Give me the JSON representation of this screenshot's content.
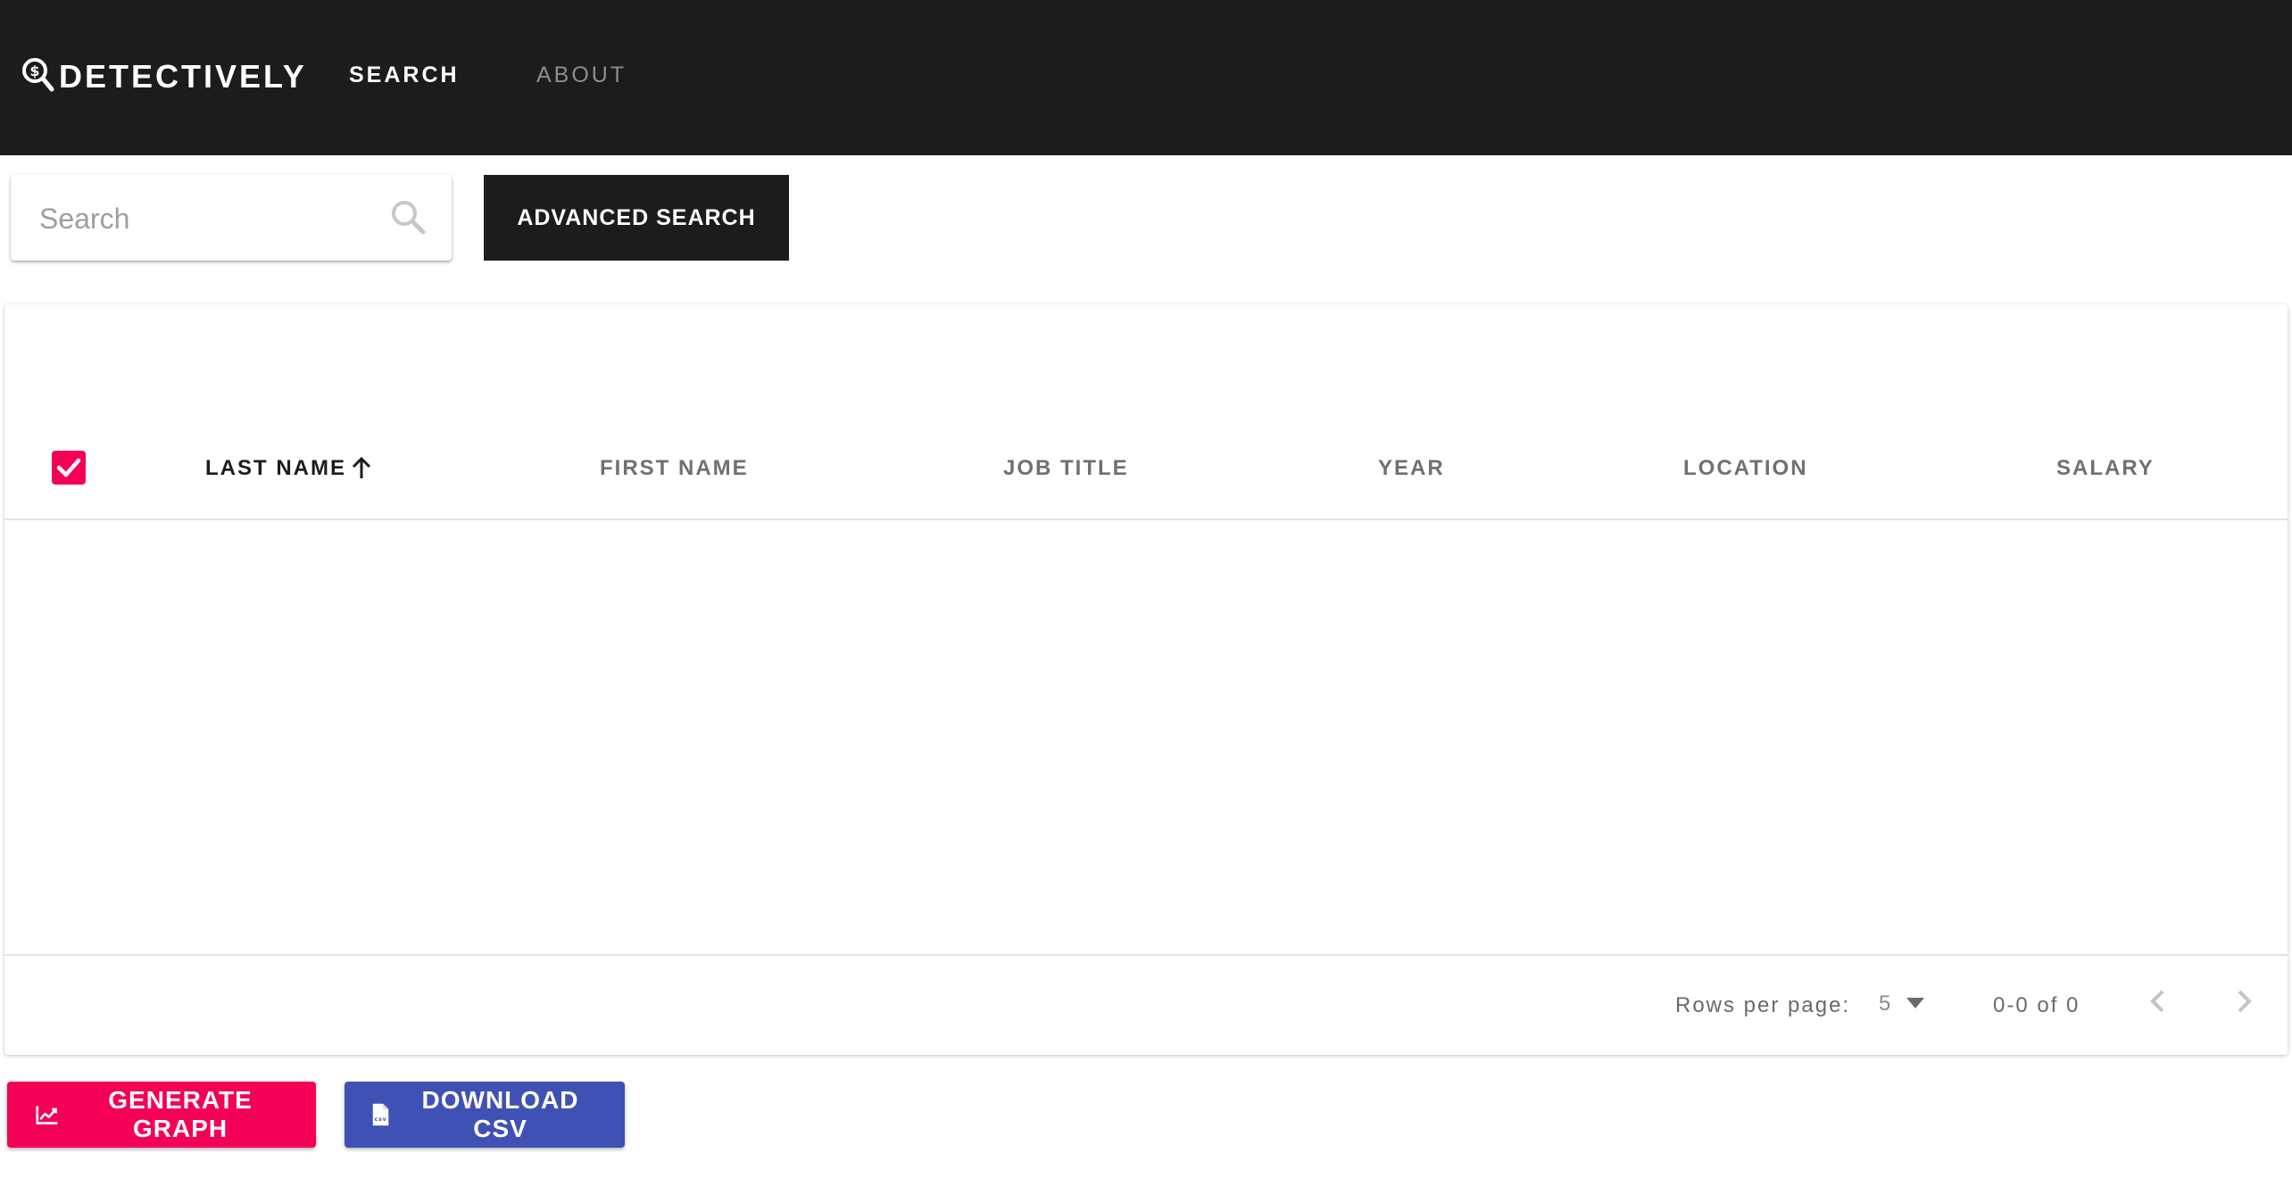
{
  "app": {
    "brand": "DETECTIVELY",
    "nav": [
      {
        "label": "SEARCH",
        "active": true
      },
      {
        "label": "ABOUT",
        "active": false
      }
    ]
  },
  "search": {
    "placeholder": "Search",
    "value": "",
    "advanced_label": "ADVANCED SEARCH"
  },
  "table": {
    "select_all_checked": true,
    "columns": [
      {
        "label": "LAST NAME",
        "sorted": "ascending"
      },
      {
        "label": "FIRST NAME"
      },
      {
        "label": "JOB TITLE"
      },
      {
        "label": "YEAR"
      },
      {
        "label": "LOCATION"
      },
      {
        "label": "SALARY"
      }
    ],
    "rows": [],
    "pagination": {
      "rows_per_page_label": "Rows per page:",
      "rows_per_page": "5",
      "range": "0-0 of 0"
    }
  },
  "actions": {
    "generate_graph": "GENERATE GRAPH",
    "download_csv": "DOWNLOAD CSV"
  },
  "colors": {
    "topbar": "#1c1c1c",
    "accent_pink": "#f50057",
    "accent_indigo": "#3f51b5"
  },
  "icons": {
    "brand": "magnifier-dollar-icon",
    "search": "search-icon",
    "sort": "arrow-up-icon",
    "dropdown": "caret-down-icon",
    "prev": "chevron-left-icon",
    "next": "chevron-right-icon",
    "graph": "chart-line-icon",
    "csv": "csv-file-icon"
  }
}
